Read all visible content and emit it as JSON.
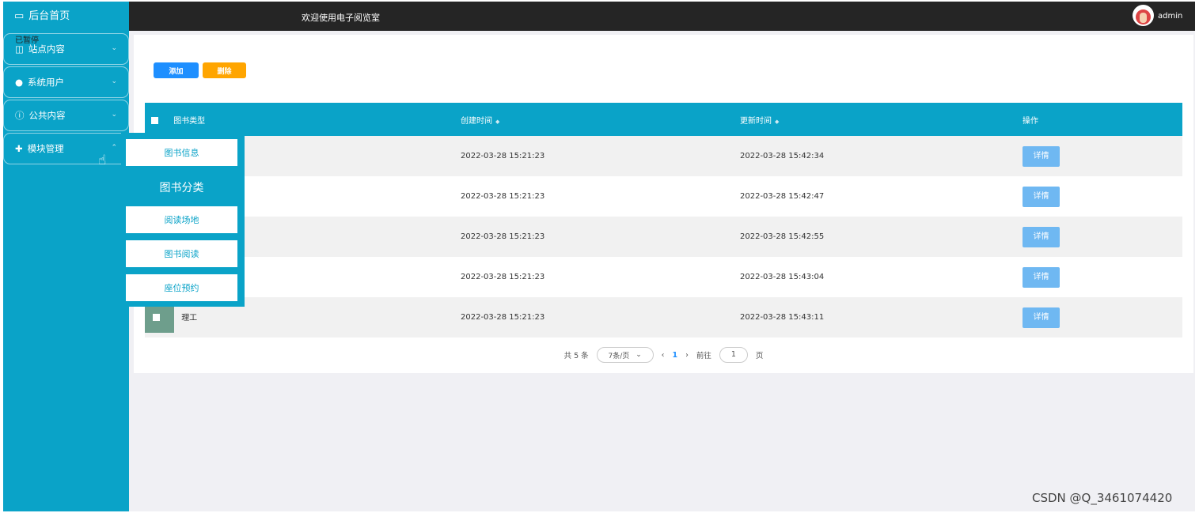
{
  "app": {
    "home_label": "后台首页",
    "welcome_title": "欢迎使用电子阅览室",
    "username": "admin"
  },
  "paused_overlay": "已暂停",
  "sidebar": {
    "items": [
      {
        "label": "站点内容"
      },
      {
        "label": "系统用户"
      },
      {
        "label": "公共内容"
      },
      {
        "label": "模块管理"
      }
    ]
  },
  "submenu": {
    "items": [
      "图书信息",
      "图书分类",
      "阅读场地",
      "图书阅读",
      "座位预约"
    ],
    "active": "图书分类"
  },
  "toolbar": {
    "add_label": "添加",
    "delete_label": "删除"
  },
  "table": {
    "headers": {
      "type": "图书类型",
      "created": "创建时间",
      "updated": "更新时间",
      "actions": "操作"
    },
    "rows": [
      {
        "type": "",
        "created": "2022-03-28 15:21:23",
        "updated": "2022-03-28 15:42:34"
      },
      {
        "type": "",
        "created": "2022-03-28 15:21:23",
        "updated": "2022-03-28 15:42:47"
      },
      {
        "type": "",
        "created": "2022-03-28 15:21:23",
        "updated": "2022-03-28 15:42:55"
      },
      {
        "type": "",
        "created": "2022-03-28 15:21:23",
        "updated": "2022-03-28 15:43:04"
      },
      {
        "type": "理工",
        "created": "2022-03-28 15:21:23",
        "updated": "2022-03-28 15:43:11"
      }
    ],
    "detail_label": "详情"
  },
  "pagination": {
    "total": "共 5 条",
    "page_size": "7条/页",
    "current_page": "1",
    "goto_label": "前往",
    "goto_value": "1",
    "page_suffix": "页"
  },
  "watermark": "CSDN @Q_3461074420",
  "colors": {
    "sidebar": "#0aa3c8",
    "topbar": "#252525",
    "add": "#1e8fff",
    "delete": "#ffa500",
    "detail": "#6fb8f2"
  }
}
